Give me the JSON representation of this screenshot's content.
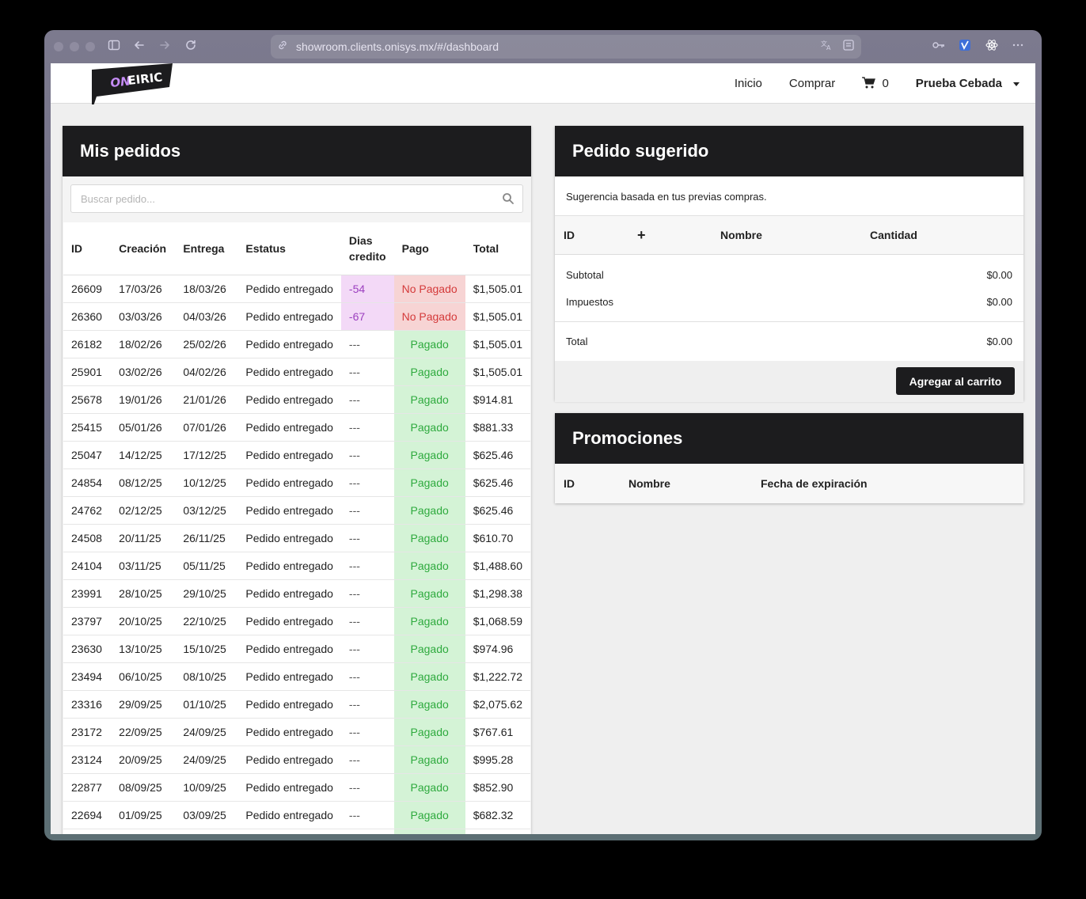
{
  "browser": {
    "url": "showroom.clients.onisys.mx/#/dashboard"
  },
  "navbar": {
    "logo_text": "ONEIRIC",
    "items": [
      "Inicio",
      "Comprar"
    ],
    "cart_count": "0",
    "user_name": "Prueba Cebada"
  },
  "orders": {
    "title": "Mis pedidos",
    "search_placeholder": "Buscar pedido...",
    "columns": [
      "ID",
      "Creación",
      "Entrega",
      "Estatus",
      "Dias credito",
      "Pago",
      "Total"
    ],
    "columns_dias_line1": "Dias",
    "columns_dias_line2": "credito",
    "rows": [
      {
        "id": "26609",
        "creacion": "17/03/26",
        "entrega": "18/03/26",
        "estatus": "Pedido entregado",
        "dias": "-54",
        "pago": "No Pagado",
        "total": "$1,505.01"
      },
      {
        "id": "26360",
        "creacion": "03/03/26",
        "entrega": "04/03/26",
        "estatus": "Pedido entregado",
        "dias": "-67",
        "pago": "No Pagado",
        "total": "$1,505.01"
      },
      {
        "id": "26182",
        "creacion": "18/02/26",
        "entrega": "25/02/26",
        "estatus": "Pedido entregado",
        "dias": "---",
        "pago": "Pagado",
        "total": "$1,505.01"
      },
      {
        "id": "25901",
        "creacion": "03/02/26",
        "entrega": "04/02/26",
        "estatus": "Pedido entregado",
        "dias": "---",
        "pago": "Pagado",
        "total": "$1,505.01"
      },
      {
        "id": "25678",
        "creacion": "19/01/26",
        "entrega": "21/01/26",
        "estatus": "Pedido entregado",
        "dias": "---",
        "pago": "Pagado",
        "total": "$914.81"
      },
      {
        "id": "25415",
        "creacion": "05/01/26",
        "entrega": "07/01/26",
        "estatus": "Pedido entregado",
        "dias": "---",
        "pago": "Pagado",
        "total": "$881.33"
      },
      {
        "id": "25047",
        "creacion": "14/12/25",
        "entrega": "17/12/25",
        "estatus": "Pedido entregado",
        "dias": "---",
        "pago": "Pagado",
        "total": "$625.46"
      },
      {
        "id": "24854",
        "creacion": "08/12/25",
        "entrega": "10/12/25",
        "estatus": "Pedido entregado",
        "dias": "---",
        "pago": "Pagado",
        "total": "$625.46"
      },
      {
        "id": "24762",
        "creacion": "02/12/25",
        "entrega": "03/12/25",
        "estatus": "Pedido entregado",
        "dias": "---",
        "pago": "Pagado",
        "total": "$625.46"
      },
      {
        "id": "24508",
        "creacion": "20/11/25",
        "entrega": "26/11/25",
        "estatus": "Pedido entregado",
        "dias": "---",
        "pago": "Pagado",
        "total": "$610.70"
      },
      {
        "id": "24104",
        "creacion": "03/11/25",
        "entrega": "05/11/25",
        "estatus": "Pedido entregado",
        "dias": "---",
        "pago": "Pagado",
        "total": "$1,488.60"
      },
      {
        "id": "23991",
        "creacion": "28/10/25",
        "entrega": "29/10/25",
        "estatus": "Pedido entregado",
        "dias": "---",
        "pago": "Pagado",
        "total": "$1,298.38"
      },
      {
        "id": "23797",
        "creacion": "20/10/25",
        "entrega": "22/10/25",
        "estatus": "Pedido entregado",
        "dias": "---",
        "pago": "Pagado",
        "total": "$1,068.59"
      },
      {
        "id": "23630",
        "creacion": "13/10/25",
        "entrega": "15/10/25",
        "estatus": "Pedido entregado",
        "dias": "---",
        "pago": "Pagado",
        "total": "$974.96"
      },
      {
        "id": "23494",
        "creacion": "06/10/25",
        "entrega": "08/10/25",
        "estatus": "Pedido entregado",
        "dias": "---",
        "pago": "Pagado",
        "total": "$1,222.72"
      },
      {
        "id": "23316",
        "creacion": "29/09/25",
        "entrega": "01/10/25",
        "estatus": "Pedido entregado",
        "dias": "---",
        "pago": "Pagado",
        "total": "$2,075.62"
      },
      {
        "id": "23172",
        "creacion": "22/09/25",
        "entrega": "24/09/25",
        "estatus": "Pedido entregado",
        "dias": "---",
        "pago": "Pagado",
        "total": "$767.61"
      },
      {
        "id": "23124",
        "creacion": "20/09/25",
        "entrega": "24/09/25",
        "estatus": "Pedido entregado",
        "dias": "---",
        "pago": "Pagado",
        "total": "$995.28"
      },
      {
        "id": "22877",
        "creacion": "08/09/25",
        "entrega": "10/09/25",
        "estatus": "Pedido entregado",
        "dias": "---",
        "pago": "Pagado",
        "total": "$852.90"
      },
      {
        "id": "22694",
        "creacion": "01/09/25",
        "entrega": "03/09/25",
        "estatus": "Pedido entregado",
        "dias": "---",
        "pago": "Pagado",
        "total": "$682.32"
      }
    ]
  },
  "suggested": {
    "title": "Pedido sugerido",
    "subtitle": "Sugerencia basada en tus previas compras.",
    "col_id": "ID",
    "col_add": "+",
    "col_nombre": "Nombre",
    "col_cantidad": "Cantidad",
    "subtotal_label": "Subtotal",
    "subtotal_value": "$0.00",
    "taxes_label": "Impuestos",
    "taxes_value": "$0.00",
    "total_label": "Total",
    "total_value": "$0.00",
    "add_to_cart": "Agregar al carrito"
  },
  "promotions": {
    "title": "Promociones",
    "col_id": "ID",
    "col_nombre": "Nombre",
    "col_fecha": "Fecha de expiración"
  },
  "colors": {
    "header_dark": "#1c1c1e",
    "pagado_bg": "#d4f3d6",
    "pagado_text": "#2eaa3e",
    "no_pagado_bg": "#f7d4d4",
    "no_pagado_text": "#d43a3a",
    "dias_bg": "#f3d9f7",
    "dias_text": "#9b3fbf"
  }
}
